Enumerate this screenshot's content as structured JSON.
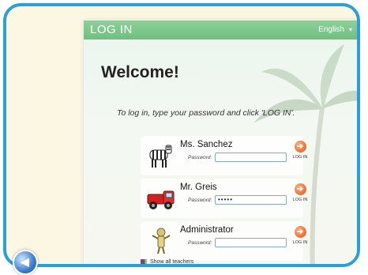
{
  "header": {
    "title": "LOG IN",
    "language": "English"
  },
  "main": {
    "welcome": "Welcome!",
    "instructions": "To log in, type your password and click 'LOG IN'."
  },
  "users": [
    {
      "name": "Ms. Sanchez",
      "password_label": "Password:",
      "password_value": "",
      "login_label": "LOG IN",
      "avatar_icon": "zebra-icon"
    },
    {
      "name": "Mr. Greis",
      "password_label": "Password:",
      "password_value": "•••••",
      "login_label": "LOG IN",
      "avatar_icon": "red-truck-icon"
    },
    {
      "name": "Administrator",
      "password_label": "Password:",
      "password_value": "",
      "login_label": "LOG IN",
      "avatar_icon": "key-figure-icon"
    }
  ],
  "footer": {
    "show_all": "Show all teachers"
  },
  "colors": {
    "frame": "#2aa0d8",
    "titlebar": "#6fbf80",
    "login_button": "#e5501e",
    "background": "#fbf7e3"
  }
}
